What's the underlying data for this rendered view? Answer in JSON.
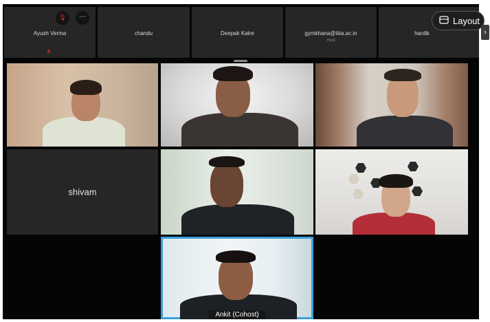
{
  "window": {
    "layout_button_label": "Layout",
    "layout_icon": "layout-grid-icon",
    "next_icon": "chevron-right-icon"
  },
  "strip": {
    "participants": [
      {
        "name": "Ayush Verma",
        "sub": ""
      },
      {
        "name": "chandu",
        "sub": ""
      },
      {
        "name": "Deepak Katre",
        "sub": ""
      },
      {
        "name": "gymkhana@iiita.ac.in",
        "sub": "Host"
      },
      {
        "name": "hardik",
        "sub": ""
      }
    ],
    "mute_icon": "mic-muted-icon",
    "more_icon": "more-options-icon"
  },
  "grid": {
    "tiles": [
      {
        "name": "",
        "video": true
      },
      {
        "name": "",
        "video": true
      },
      {
        "name": "",
        "video": true
      },
      {
        "name": "shivam",
        "video": false
      },
      {
        "name": "",
        "video": true
      },
      {
        "name": "",
        "video": true
      },
      {
        "name": "Ankit (Cohost)",
        "video": true,
        "active_speaker": true
      }
    ]
  },
  "colors": {
    "active_speaker_border": "#3aa0d8",
    "background": "#050505",
    "tile_empty": "#262626"
  }
}
